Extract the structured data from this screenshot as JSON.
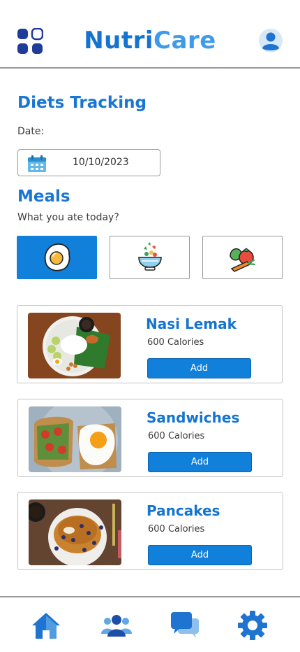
{
  "header": {
    "brand_part1": "Nutri",
    "brand_part2": "Care",
    "menu_icon": "grid-menu-icon",
    "avatar_icon": "user-avatar-icon"
  },
  "tracking": {
    "title": "Diets Tracking",
    "date_label": "Date:",
    "date_value": "10/10/2023",
    "calendar_icon": "calendar-icon"
  },
  "meals": {
    "title": "Meals",
    "subtitle": "What you ate today?",
    "categories": [
      {
        "icon": "fried-egg-icon",
        "active": true
      },
      {
        "icon": "salad-bowl-icon",
        "active": false
      },
      {
        "icon": "vegetables-icon",
        "active": false
      }
    ],
    "items": [
      {
        "name": "Nasi Lemak",
        "calories": "600 Calories",
        "button": "Add",
        "image": "nasi-lemak-photo"
      },
      {
        "name": "Sandwiches",
        "calories": "600 Calories",
        "button": "Add",
        "image": "sandwich-photo"
      },
      {
        "name": "Pancakes",
        "calories": "600 Calories",
        "button": "Add",
        "image": "pancakes-photo"
      }
    ]
  },
  "nav": {
    "items": [
      "home-icon",
      "community-icon",
      "chat-icon",
      "settings-icon"
    ]
  },
  "colors": {
    "primary": "#1474cf",
    "accent": "#3f9bea",
    "button": "#1080db"
  }
}
